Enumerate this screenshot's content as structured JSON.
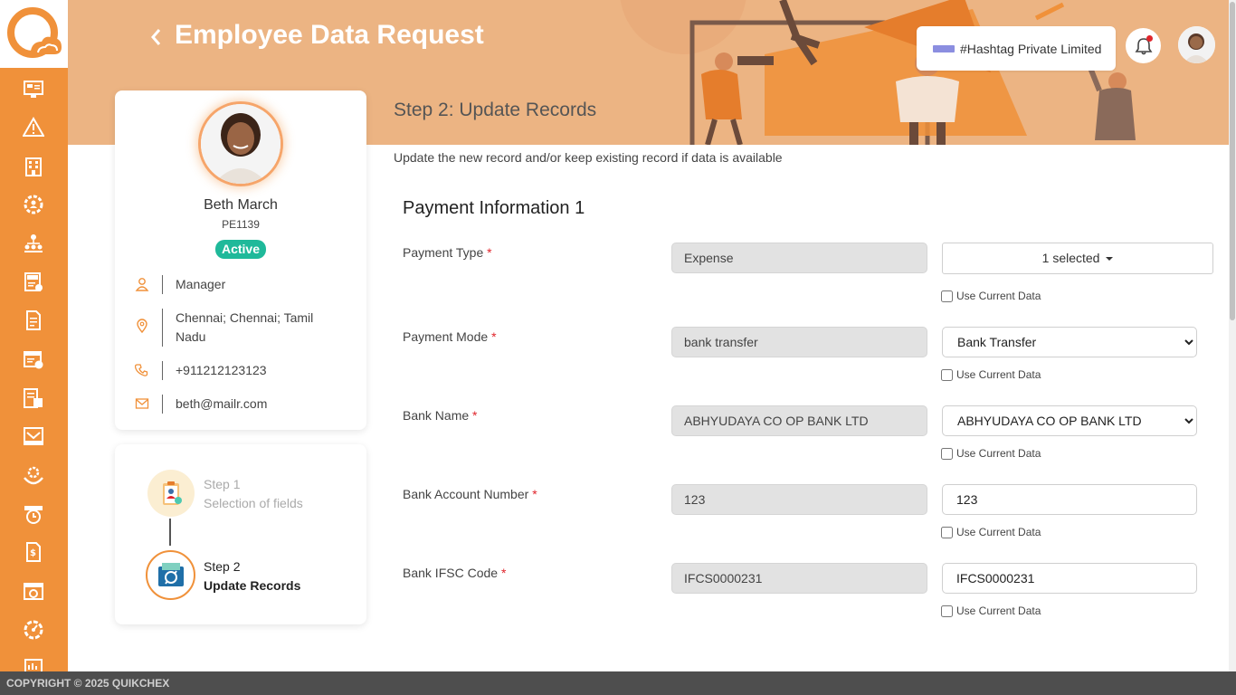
{
  "header": {
    "title": "Employee Data Request",
    "company": "#Hashtag Private Limited",
    "notification_count": "1"
  },
  "employee": {
    "name": "Beth March",
    "id": "PE1139",
    "status": "Active",
    "designation": "Manager",
    "location": "Chennai; Chennai; Tamil Nadu",
    "phone": "+911212123123",
    "email": "beth@mailr.com"
  },
  "steps": [
    {
      "number": "Step 1",
      "label": "Selection of fields",
      "active": false
    },
    {
      "number": "Step 2",
      "label": "Update Records",
      "active": true
    }
  ],
  "main": {
    "step_title": "Step 2: Update Records",
    "subtitle": "Update the new record and/or keep existing record if data is available",
    "section_title": "Payment Information 1",
    "use_current_label": "Use Current Data",
    "fields": [
      {
        "label": "Payment Type",
        "current": "Expense",
        "new": "1 selected"
      },
      {
        "label": "Payment Mode",
        "current": "bank transfer",
        "new": "Bank Transfer"
      },
      {
        "label": "Bank Name",
        "current": "ABHYUDAYA CO OP BANK LTD",
        "new": "ABHYUDAYA CO OP BANK LTD"
      },
      {
        "label": "Bank Account Number",
        "current": "123",
        "new": "123"
      },
      {
        "label": "Bank IFSC Code",
        "current": "IFCS0000231",
        "new": "IFCS0000231"
      }
    ]
  },
  "footer": {
    "copyright": "COPYRIGHT © 2025 QUIKCHEX"
  },
  "colors": {
    "accent": "#f0913a",
    "banner": "#ecb483",
    "status_active": "#1fb99a",
    "required": "#e0242b"
  },
  "sidebar_icons": [
    "dashboard-icon",
    "alert-icon",
    "building-icon",
    "settings-user-icon",
    "org-chart-icon",
    "tax-icon",
    "document-icon",
    "calendar-check-icon",
    "timesheet-icon",
    "mail-icon",
    "hand-gear-icon",
    "clock-calendar-icon",
    "payslip-icon",
    "calendar-tick-icon",
    "speedometer-icon",
    "reports-icon"
  ]
}
